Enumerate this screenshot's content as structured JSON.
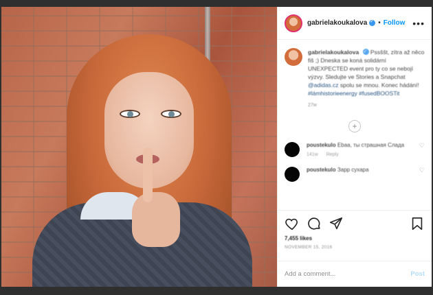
{
  "header": {
    "username": "gabrielakoukalova",
    "separator": "•",
    "follow_label": "Follow",
    "more_label": "•••"
  },
  "caption": {
    "username": "gabrielakoukalova",
    "text": "Pssššt, zítra až něco fiš ;) Dneska se koná solidární UNEXPECTED event pro ty co se nebojí výzvy. Sledujte ve Stories a Snapchat",
    "mention": "@adidas.cz",
    "text2": "spolu se mnou. Konec hádání!",
    "hashtags": "#lámhistorieenergy #fusedBOOSTit",
    "time": "27w"
  },
  "comments": [
    {
      "username": "poustekulo",
      "text": "Ebaa, ты страшная Слада",
      "time": "141w",
      "reply": "Reply"
    },
    {
      "username": "poustekulo",
      "text": "Зарр сухара",
      "time": "",
      "reply": ""
    }
  ],
  "load_more_label": "+",
  "actions": {
    "likes": "7,455 likes",
    "date": "NOVEMBER 15, 2016"
  },
  "add_comment": {
    "placeholder": "Add a comment...",
    "post_label": "Post"
  },
  "icons": [
    "heart-icon",
    "comment-icon",
    "share-icon",
    "bookmark-icon",
    "more-icon",
    "verified-icon",
    "plus-circle-icon"
  ]
}
